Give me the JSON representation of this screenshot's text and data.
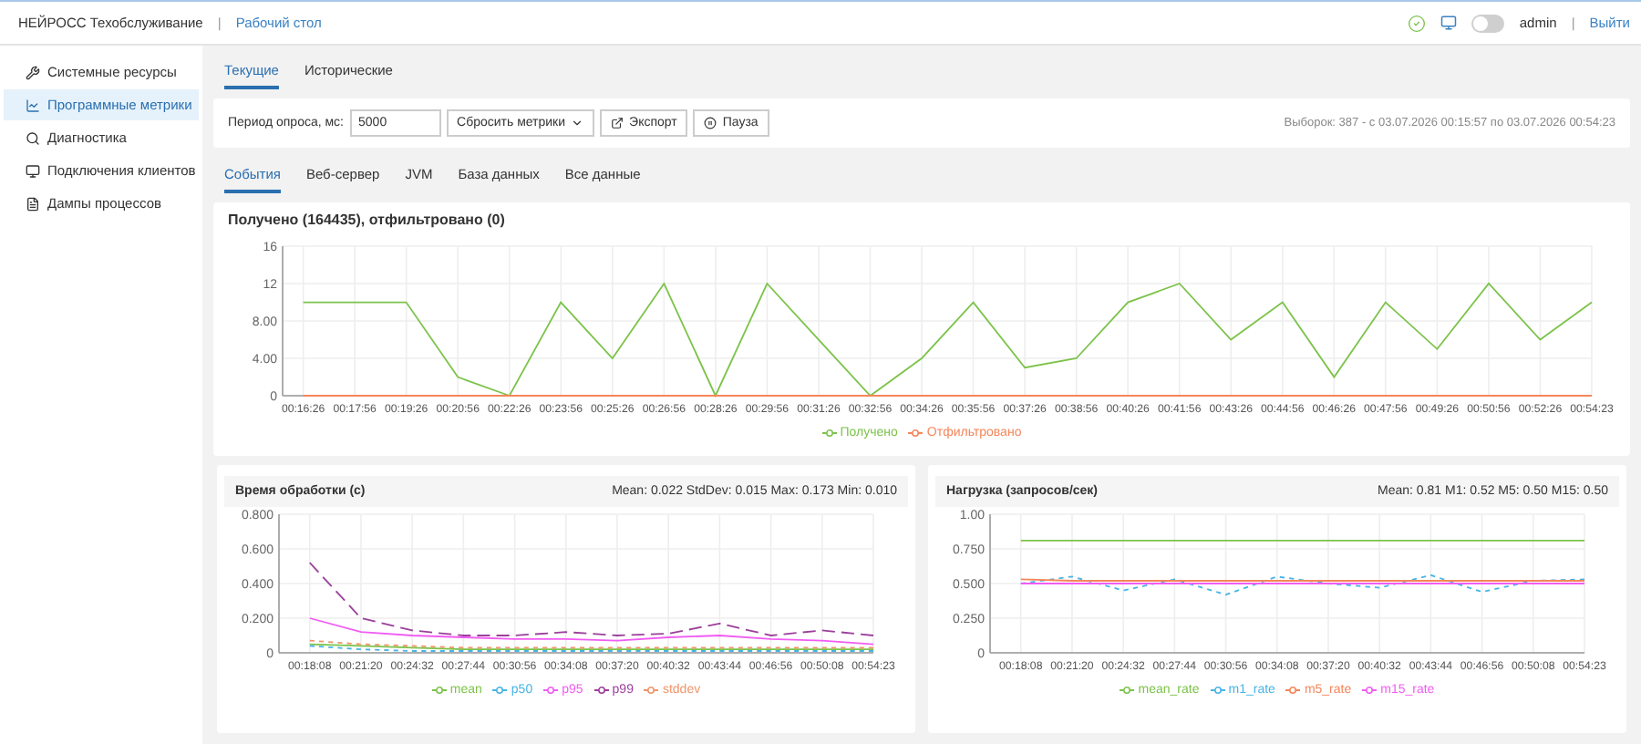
{
  "header": {
    "app_title": "НЕЙРОСС Техобслуживание",
    "separator": "|",
    "desktop_link": "Рабочий стол",
    "toggle": {
      "on": false
    },
    "user": "admin",
    "user_separator": "|",
    "logout": "Выйти"
  },
  "sidebar": {
    "items": [
      {
        "label": "Системные ресурсы",
        "selected": false
      },
      {
        "label": "Программные метрики",
        "selected": true
      },
      {
        "label": "Диагностика",
        "selected": false
      },
      {
        "label": "Подключения клиентов",
        "selected": false
      },
      {
        "label": "Дампы процессов",
        "selected": false
      }
    ]
  },
  "tabs": [
    {
      "label": "Текущие",
      "selected": true
    },
    {
      "label": "Исторические",
      "selected": false
    }
  ],
  "toolbar": {
    "period_label": "Период опроса, мс:",
    "period_value": "5000",
    "reset_button": "Сбросить метрики",
    "export_button": "Экспорт",
    "pause_button": "Пауза",
    "samples": "Выборок: 387 - с 03.07.2026 00:15:57 по 03.07.2026 00:54:23"
  },
  "subtabs": [
    {
      "label": "События",
      "selected": true
    },
    {
      "label": "Веб-сервер",
      "selected": false
    },
    {
      "label": "JVM",
      "selected": false
    },
    {
      "label": "База данных",
      "selected": false
    },
    {
      "label": "Все данные",
      "selected": false
    }
  ],
  "events_panel": {
    "title": "Получено (164435), отфильтровано (0)",
    "chart_data": {
      "type": "line",
      "grid": true,
      "legend": "bottom",
      "ylim": [
        0,
        16
      ],
      "yticks": [
        {
          "value": 0,
          "label": "0"
        },
        {
          "value": 4,
          "label": "4.00"
        },
        {
          "value": 8,
          "label": "8.00"
        },
        {
          "value": 12,
          "label": "12"
        },
        {
          "value": 16,
          "label": "16"
        }
      ],
      "categories": [
        "00:16:26",
        "00:17:56",
        "00:19:26",
        "00:20:56",
        "00:22:26",
        "00:23:56",
        "00:25:26",
        "00:26:56",
        "00:28:26",
        "00:29:56",
        "00:31:26",
        "00:32:56",
        "00:34:26",
        "00:35:56",
        "00:37:26",
        "00:38:56",
        "00:40:26",
        "00:41:56",
        "00:43:26",
        "00:44:56",
        "00:46:26",
        "00:47:56",
        "00:49:26",
        "00:50:56",
        "00:52:26",
        "00:54:23"
      ],
      "series": [
        {
          "name": "Получено",
          "color": "#7cc34a",
          "values": [
            10,
            10,
            10,
            2,
            0,
            10,
            4,
            12,
            0,
            12,
            6,
            0,
            4,
            10,
            3,
            4,
            10,
            12,
            6,
            10,
            2,
            10,
            5,
            12,
            6,
            10
          ]
        },
        {
          "name": "Отфильтровано",
          "color": "#f5865a",
          "values": [
            0,
            0,
            0,
            0,
            0,
            0,
            0,
            0,
            0,
            0,
            0,
            0,
            0,
            0,
            0,
            0,
            0,
            0,
            0,
            0,
            0,
            0,
            0,
            0,
            0,
            0
          ]
        }
      ]
    }
  },
  "processing_panel": {
    "title": "Время обработки (с)",
    "stats": "Mean: 0.022 StdDev: 0.015 Max: 0.173 Min: 0.010",
    "chart_data": {
      "type": "line",
      "grid": true,
      "legend": "bottom",
      "ylim": [
        0,
        0.8
      ],
      "yticks": [
        {
          "value": 0,
          "label": "0"
        },
        {
          "value": 0.2,
          "label": "0.200"
        },
        {
          "value": 0.4,
          "label": "0.400"
        },
        {
          "value": 0.6,
          "label": "0.600"
        },
        {
          "value": 0.8,
          "label": "0.800"
        }
      ],
      "categories": [
        "00:18:08",
        "00:21:20",
        "00:24:32",
        "00:27:44",
        "00:30:56",
        "00:34:08",
        "00:37:20",
        "00:40:32",
        "00:43:44",
        "00:46:56",
        "00:50:08",
        "00:54:23"
      ],
      "series": [
        {
          "name": "mean",
          "color": "#7cc34a",
          "values": [
            0.05,
            0.04,
            0.03,
            0.02,
            0.02,
            0.02,
            0.02,
            0.02,
            0.02,
            0.02,
            0.02,
            0.02
          ]
        },
        {
          "name": "p50",
          "color": "#47b4e6",
          "line_style": "dotted",
          "values": [
            0.04,
            0.02,
            0.01,
            0.01,
            0.01,
            0.01,
            0.01,
            0.01,
            0.01,
            0.01,
            0.01,
            0.01
          ]
        },
        {
          "name": "p95",
          "color": "#f15cf2",
          "values": [
            0.2,
            0.12,
            0.1,
            0.09,
            0.08,
            0.08,
            0.07,
            0.09,
            0.1,
            0.08,
            0.07,
            0.05
          ]
        },
        {
          "name": "p99",
          "color": "#9b3f9b",
          "line_style": "dashed",
          "values": [
            0.52,
            0.2,
            0.13,
            0.1,
            0.1,
            0.12,
            0.1,
            0.11,
            0.17,
            0.1,
            0.13,
            0.1
          ]
        },
        {
          "name": "stddev",
          "color": "#f0956a",
          "line_style": "dotted",
          "values": [
            0.07,
            0.05,
            0.04,
            0.03,
            0.03,
            0.03,
            0.03,
            0.03,
            0.03,
            0.03,
            0.03,
            0.03
          ]
        }
      ]
    }
  },
  "load_panel": {
    "title": "Нагрузка (запросов/сек)",
    "stats": "Mean: 0.81 M1: 0.52 M5: 0.50 M15: 0.50",
    "chart_data": {
      "type": "line",
      "grid": true,
      "legend": "bottom",
      "ylim": [
        0,
        1
      ],
      "yticks": [
        {
          "value": 0,
          "label": "0"
        },
        {
          "value": 0.25,
          "label": "0.250"
        },
        {
          "value": 0.5,
          "label": "0.500"
        },
        {
          "value": 0.75,
          "label": "0.750"
        },
        {
          "value": 1,
          "label": "1.00"
        }
      ],
      "categories": [
        "00:18:08",
        "00:21:20",
        "00:24:32",
        "00:27:44",
        "00:30:56",
        "00:34:08",
        "00:37:20",
        "00:40:32",
        "00:43:44",
        "00:46:56",
        "00:50:08",
        "00:54:23"
      ],
      "series": [
        {
          "name": "mean_rate",
          "color": "#7cc34a",
          "values": [
            0.81,
            0.81,
            0.81,
            0.81,
            0.81,
            0.81,
            0.81,
            0.81,
            0.81,
            0.81,
            0.81,
            0.81
          ]
        },
        {
          "name": "m1_rate",
          "color": "#47b4e6",
          "line_style": "dotted",
          "values": [
            0.5,
            0.55,
            0.45,
            0.53,
            0.42,
            0.55,
            0.5,
            0.47,
            0.56,
            0.44,
            0.52,
            0.53
          ]
        },
        {
          "name": "m5_rate",
          "color": "#f5865a",
          "values": [
            0.53,
            0.52,
            0.52,
            0.52,
            0.52,
            0.52,
            0.52,
            0.52,
            0.52,
            0.52,
            0.52,
            0.52
          ]
        },
        {
          "name": "m15_rate",
          "color": "#f15cf2",
          "values": [
            0.5,
            0.5,
            0.5,
            0.5,
            0.5,
            0.5,
            0.5,
            0.5,
            0.5,
            0.5,
            0.5,
            0.5
          ]
        }
      ]
    }
  }
}
